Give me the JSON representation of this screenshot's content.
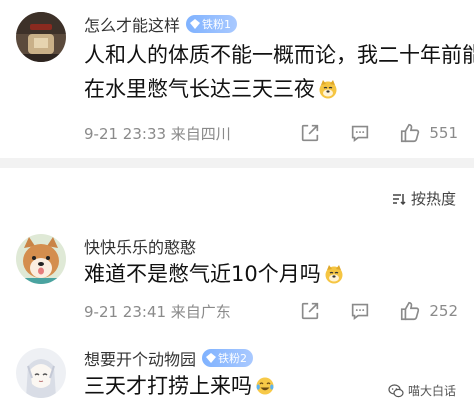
{
  "comments": [
    {
      "username": "怎么才能这样",
      "badge": "铁粉1",
      "text_line1": "人和人的体质不能一概而论，我二十年前能",
      "text_line2": "在水里憋气长达三天三夜",
      "emoji": "doge-emoji",
      "time": "9-21 23:33 来自四川",
      "likes": "551"
    },
    {
      "username": "快快乐乐的憨憨",
      "badge": "",
      "text_line1": "难道不是憋气近10个月吗",
      "emoji": "doge-emoji",
      "time": "9-21 23:41 来自广东",
      "likes": "252"
    },
    {
      "username": "想要开个动物园",
      "badge": "铁粉2",
      "text_line1": "三天才打捞上来吗",
      "emoji": "tears-of-joy-emoji"
    }
  ],
  "sort": {
    "label": "按热度",
    "icon": "sort-icon"
  },
  "watermark": {
    "label": "喵大白话",
    "icon": "wechat-icon"
  },
  "colors": {
    "badge": "#8db9ff",
    "meta": "#8a8a8a",
    "divider": "#f2f2f2"
  }
}
